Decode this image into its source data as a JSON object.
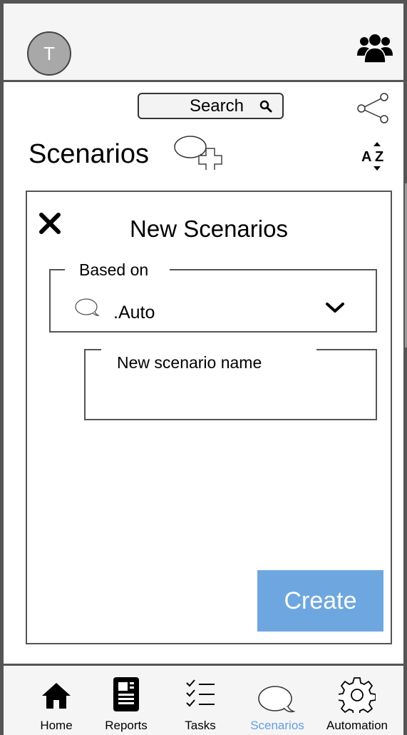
{
  "header": {
    "avatar_initial": "T",
    "user_icon": "people-icon"
  },
  "toolbar": {
    "search_label": "Search",
    "search_icon": "search-icon",
    "share_icon": "share-icon",
    "sort_icon": "sort-az-icon"
  },
  "page": {
    "title": "Scenarios",
    "add_icon": "add-scenario-icon"
  },
  "dialog": {
    "title": "New Scenarios",
    "close_icon": "close-icon",
    "based_on": {
      "label": "Based on",
      "value": ".Auto",
      "icon": "speech-bubble-icon"
    },
    "name_field": {
      "label": "New scenario name",
      "value": ""
    },
    "create_label": "Create"
  },
  "nav": {
    "items": [
      {
        "label": "Home",
        "icon": "home-icon",
        "active": false
      },
      {
        "label": "Reports",
        "icon": "reports-icon",
        "active": false
      },
      {
        "label": "Tasks",
        "icon": "tasks-icon",
        "active": false
      },
      {
        "label": "Scenarios",
        "icon": "speech-bubble-icon",
        "active": true
      },
      {
        "label": "Automation",
        "icon": "gear-icon",
        "active": false
      }
    ]
  },
  "colors": {
    "accent": "#6ea7df",
    "active_nav": "#5f9fe3",
    "frame": "#555555"
  }
}
